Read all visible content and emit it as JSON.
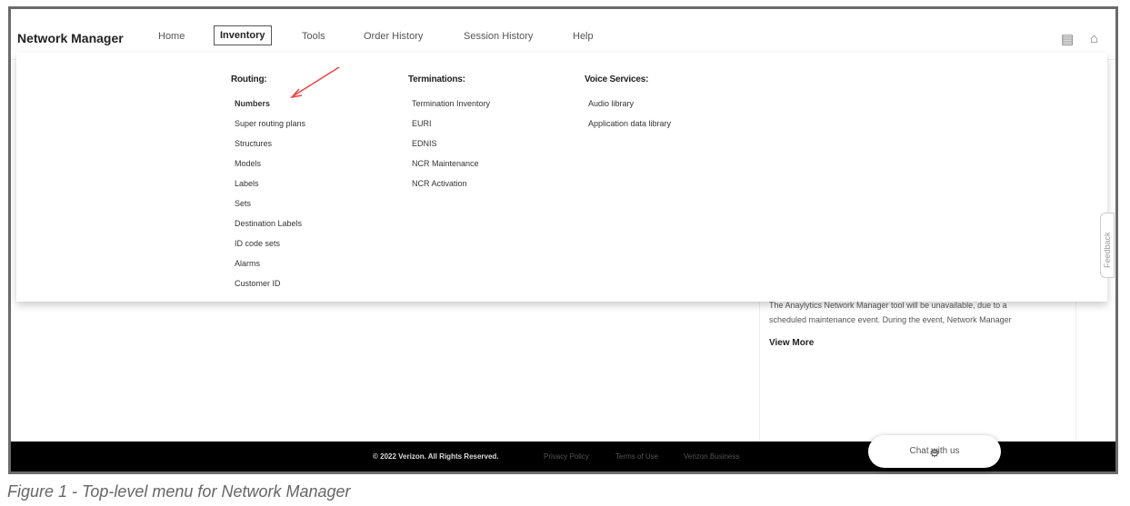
{
  "header": {
    "brand": "Network Manager",
    "nav": [
      "Home",
      "Inventory",
      "Tools",
      "Order History",
      "Session History",
      "Help"
    ],
    "icons": [
      "document-icon",
      "home-icon"
    ]
  },
  "menu": {
    "routing": {
      "title": "Routing:",
      "items": [
        "Numbers",
        "Super routing plans",
        "Structures",
        "Models",
        "Labels",
        "Sets",
        "Destination Labels",
        "ID code sets",
        "Alarms",
        "Customer ID"
      ]
    },
    "terminations": {
      "title": "Terminations:",
      "items": [
        "Termination Inventory",
        "EURI",
        "EDNIS",
        "NCR Maintenance",
        "NCR Activation"
      ]
    },
    "voice": {
      "title": "Voice Services:",
      "items": [
        "Audio library",
        "Application data library"
      ]
    }
  },
  "feedback": "Feedback",
  "notice": {
    "text1": "The Anaylytics Network Manager tool will be unavailable, due to a",
    "text2": "scheduled maintenance event. During the event, Network Manager",
    "link": "View More"
  },
  "footer": {
    "copyright": "© 2022 Verizon. All Rights Reserved.",
    "links": [
      "Privacy Policy",
      "Terms of Use",
      "Verizon Business"
    ],
    "chat": "Chat with us"
  },
  "caption": "Figure 1 - Top-level menu for Network Manager",
  "colors": {
    "accent": "#e44",
    "footer": "#000000"
  }
}
